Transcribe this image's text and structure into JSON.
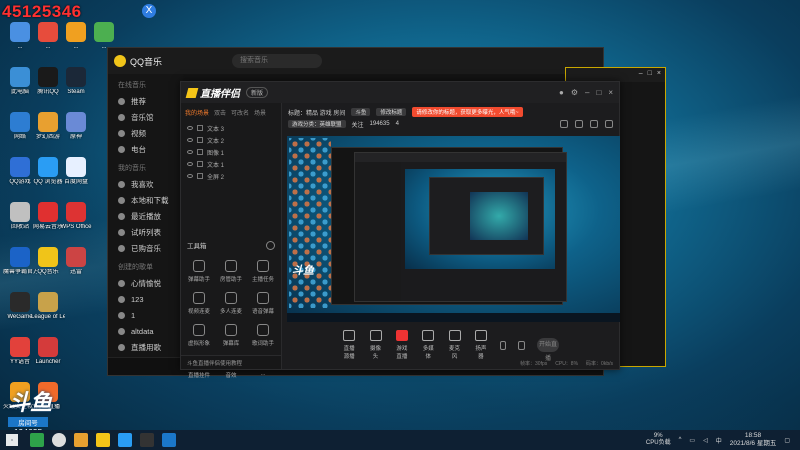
{
  "overlay": {
    "number": "45125346",
    "badge": "X"
  },
  "colors": {
    "accent": "#f47c2d",
    "record": "#e33333",
    "brand_yellow": "#f5c518",
    "taskbar": "#0e2033"
  },
  "desktop_icons": [
    {
      "label": "...",
      "color": "#4a90e2",
      "col": 0,
      "row": 0
    },
    {
      "label": "...",
      "color": "#e74c3c",
      "col": 1,
      "row": 0
    },
    {
      "label": "...",
      "color": "#f0a020",
      "col": 2,
      "row": 0
    },
    {
      "label": "...",
      "color": "#4caf50",
      "col": 3,
      "row": 0
    },
    {
      "label": "此电脑",
      "color": "#3b8fd6",
      "col": 0,
      "row": 1
    },
    {
      "label": "腾讯QQ",
      "color": "#1a1a1a",
      "col": 1,
      "row": 1
    },
    {
      "label": "Steam",
      "color": "#1b2838",
      "col": 2,
      "row": 1
    },
    {
      "label": "网络",
      "color": "#2d7dd2",
      "col": 0,
      "row": 2
    },
    {
      "label": "梦幻西游",
      "color": "#e8a030",
      "col": 1,
      "row": 2
    },
    {
      "label": "原神",
      "color": "#6a8ad6",
      "col": 2,
      "row": 2
    },
    {
      "label": "QQ游戏",
      "color": "#2f6fd6",
      "col": 0,
      "row": 3
    },
    {
      "label": "QQ 浏览器",
      "color": "#2a9df4",
      "col": 1,
      "row": 3
    },
    {
      "label": "百度网盘",
      "color": "#e7f0ff",
      "col": 2,
      "row": 3
    },
    {
      "label": "回收站",
      "color": "#c0c0c0",
      "col": 0,
      "row": 4
    },
    {
      "label": "网易云音乐",
      "color": "#e03030",
      "col": 1,
      "row": 4
    },
    {
      "label": "WPS Office",
      "color": "#d33",
      "col": 2,
      "row": 4
    },
    {
      "label": "魔兽争霸官方对战平台",
      "color": "#1b63c7",
      "col": 0,
      "row": 5
    },
    {
      "label": "QQ音乐",
      "color": "#f0c419",
      "col": 1,
      "row": 5
    },
    {
      "label": "迅雷",
      "color": "#c44",
      "col": 2,
      "row": 5
    },
    {
      "label": "WeGame",
      "color": "#2a2a2a",
      "col": 0,
      "row": 6
    },
    {
      "label": "League of Legends",
      "color": "#c8a24a",
      "col": 1,
      "row": 6
    },
    {
      "label": "YY语音",
      "color": "#e2413b",
      "col": 0,
      "row": 7
    },
    {
      "label": "Launcher",
      "color": "#d43b3b",
      "col": 1,
      "row": 7
    },
    {
      "label": "火绒安全软件",
      "color": "#f0a020",
      "col": 0,
      "row": 8
    },
    {
      "label": "斗鱼直播",
      "color": "#f06a2a",
      "col": 1,
      "row": 8
    }
  ],
  "qq_music": {
    "title": "QQ音乐",
    "search_placeholder": "搜索音乐",
    "section_online": "在线音乐",
    "nav": [
      "推荐",
      "音乐馆",
      "视频",
      "电台"
    ],
    "section_mine": "我的音乐",
    "mine": [
      "我喜欢",
      "本地和下载",
      "最近播放",
      "试听列表",
      "已购音乐"
    ],
    "section_created": "创建的歌单",
    "playlists": [
      "心情愉悦",
      "123",
      "1",
      "altdata",
      "直播用歌"
    ]
  },
  "zb": {
    "brand": "直播伴侣",
    "version": "新版",
    "tabs": [
      "我的场景",
      "双击",
      "可改名",
      "场景"
    ],
    "sources": [
      "文本 3",
      "文本 2",
      "图像 1",
      "文本 1",
      "全屏 2"
    ],
    "tools_title": "工具箱",
    "tools": [
      "弹幕助手",
      "房管助手",
      "主播任务",
      "视频连麦",
      "多人连麦",
      "语音弹幕",
      "虚拟形象",
      "弹幕库",
      "歌词助手",
      "直播挂件",
      "音效",
      "..."
    ],
    "left_footer": "斗鱼直播伴侣使用教程",
    "room_info": "标题：精品 游戏 房间",
    "chip1": "斗鱼",
    "chip2": "修改标题",
    "promo": "请修改你的标题，获取更多曝光，人气哦~",
    "category": "游戏分类：英雄联盟",
    "fans_label": "关注",
    "fans_value": "194635",
    "viewers": "4",
    "controls": [
      "直播源播",
      "摄像头",
      "游戏直播",
      "多媒体",
      "麦克风",
      "扬声器"
    ],
    "start_button": "开始直播",
    "status": [
      "帧率：30fps",
      "CPU：8%",
      "码率：0kb/s"
    ]
  },
  "fish": {
    "brand": "斗鱼",
    "room_label": "房间号",
    "room_number": "194635"
  },
  "taskbar": {
    "cpu_pct": "9%",
    "cpu_label": "CPU负载",
    "time": "18:58",
    "date": "2021/8/6 星期五",
    "ime": "中"
  }
}
